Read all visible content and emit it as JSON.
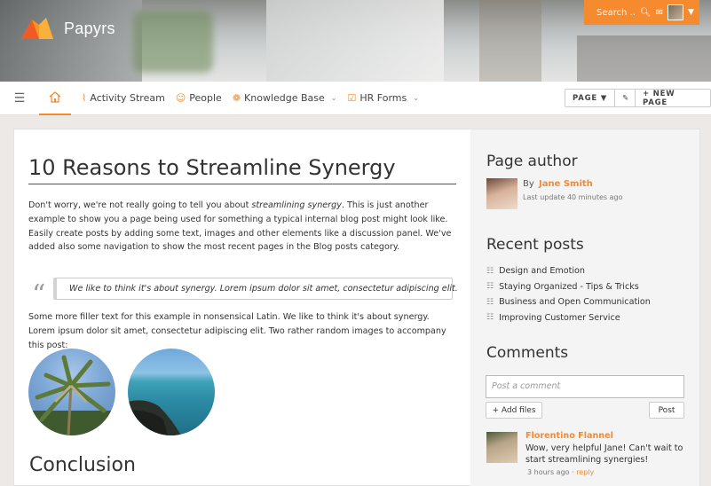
{
  "app": {
    "name": "Papyrs"
  },
  "topbar": {
    "search_placeholder": "Search ..",
    "search_icon": "magnifier-icon",
    "bell_icon": "megaphone-icon",
    "user_icon": "avatar"
  },
  "nav": {
    "items": [
      {
        "label": "Activity Stream",
        "icon": "pulse-icon"
      },
      {
        "label": "People",
        "icon": "people-icon"
      },
      {
        "label": "Knowledge Base",
        "icon": "brain-icon",
        "has_dropdown": true
      },
      {
        "label": "HR Forms",
        "icon": "clipboard-icon",
        "has_dropdown": true
      }
    ],
    "page_button": "PAGE ▼",
    "new_page_button": "+ NEW PAGE"
  },
  "article": {
    "title": "10 Reasons to Streamline Synergy",
    "intro_pre": "Don't worry, we're not really going to tell you about ",
    "intro_em": "streamlining synergy",
    "intro_post": ". This is just another example to show you a page being used for something a typical internal blog post might look like. Easily create posts by adding some text, images and other elements like a discussion panel. We've added also some navigation to show the most recent pages in the Blog posts category.",
    "quote": "We like to think it's about synergy. Lorem ipsum dolor sit amet, consectetur adipiscing elit.",
    "filler": "Some more filler text for this example in nonsensical Latin. We like to think it's about synergy. Lorem ipsum dolor sit amet, consectetur adipiscing elit. Two rather random images to accompany this post:",
    "conclusion_heading": "Conclusion"
  },
  "sidebar": {
    "author_heading": "Page author",
    "author_by": "By",
    "author_name": "Jane Smith",
    "author_update": "Last update 40 minutes ago",
    "recent_heading": "Recent posts",
    "recent_posts": [
      "Design and Emotion",
      "Staying Organized - Tips & Tricks",
      "Business and Open Communication",
      "Improving Customer Service"
    ],
    "comments_heading": "Comments",
    "comment_placeholder": "Post a comment",
    "add_files": "+ Add files",
    "post": "Post",
    "comment": {
      "author": "Florentino Flannel",
      "text": "Wow, very helpful Jane! Can't wait to start streamlining synergies!",
      "time": "3 hours ago",
      "separator": "·",
      "reply": "reply"
    }
  },
  "colors": {
    "accent": "#f58a2f"
  }
}
